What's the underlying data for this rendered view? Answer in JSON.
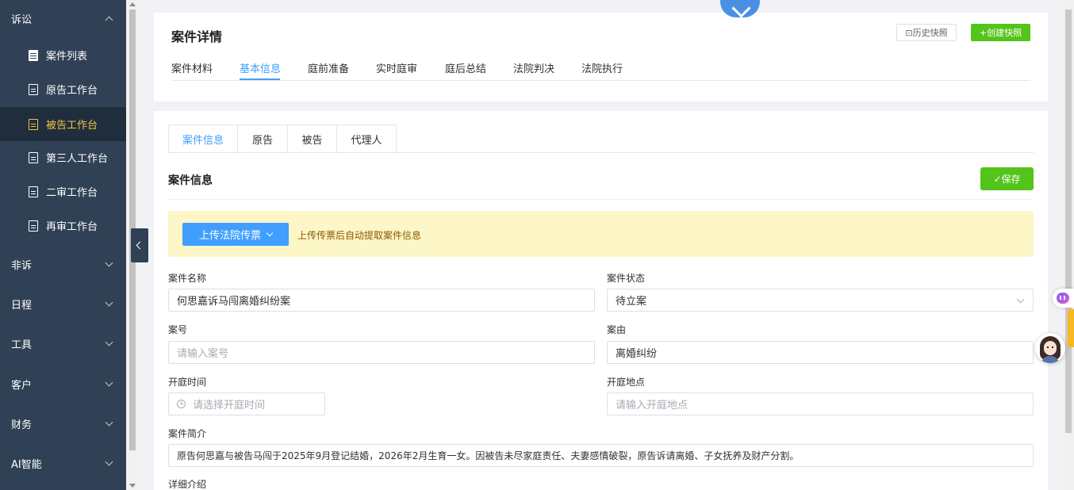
{
  "sidebar": {
    "groups": [
      {
        "label": "诉讼",
        "expanded": true
      },
      {
        "label": "非诉"
      },
      {
        "label": "日程"
      },
      {
        "label": "工具"
      },
      {
        "label": "客户"
      },
      {
        "label": "财务"
      },
      {
        "label": "AI智能"
      }
    ],
    "items": [
      {
        "label": "案件列表",
        "icon": "list-icon"
      },
      {
        "label": "原告工作台",
        "icon": "document-icon"
      },
      {
        "label": "被告工作台",
        "icon": "document-icon",
        "active": true
      },
      {
        "label": "第三人工作台",
        "icon": "document-icon"
      },
      {
        "label": "二审工作台",
        "icon": "document-icon"
      },
      {
        "label": "再审工作台",
        "icon": "document-icon"
      }
    ]
  },
  "header": {
    "title": "案件详情",
    "history_button": "⊡历史快照",
    "create_button": "+创建快照",
    "tabs": [
      "案件材料",
      "基本信息",
      "庭前准备",
      "实时庭审",
      "庭后总结",
      "法院判决",
      "法院执行"
    ],
    "active_tab": "基本信息"
  },
  "content": {
    "sub_tabs": [
      "案件信息",
      "原告",
      "被告",
      "代理人"
    ],
    "active_sub_tab": "案件信息",
    "section_title": "案件信息",
    "save_button": "✓保存",
    "notice": {
      "upload_button": "上传法院传票",
      "text": "上传传票后自动提取案件信息"
    },
    "fields": {
      "case_name": {
        "label": "案件名称",
        "value": "何思嘉诉马闯离婚纠纷案"
      },
      "case_status": {
        "label": "案件状态",
        "value": "待立案"
      },
      "case_number": {
        "label": "案号",
        "placeholder": "请输入案号"
      },
      "cause": {
        "label": "案由",
        "value": "离婚纠纷"
      },
      "hearing_time": {
        "label": "开庭时间",
        "placeholder": "请选择开庭时间"
      },
      "hearing_place": {
        "label": "开庭地点",
        "placeholder": "请输入开庭地点"
      },
      "summary": {
        "label": "案件简介",
        "value": "原告何思嘉与被告马闯于2025年9月登记结婚，2026年2月生育一女。因被告未尽家庭责任、夫妻感情破裂，原告诉请离婚、子女抚养及财产分割。"
      },
      "detail": {
        "label": "详细介绍"
      }
    }
  },
  "colors": {
    "sidebar_bg": "#304156",
    "active_menu_text": "#f4c542",
    "primary": "#409eff",
    "success": "#52c41a",
    "notice_bg": "#fdf6c7"
  }
}
